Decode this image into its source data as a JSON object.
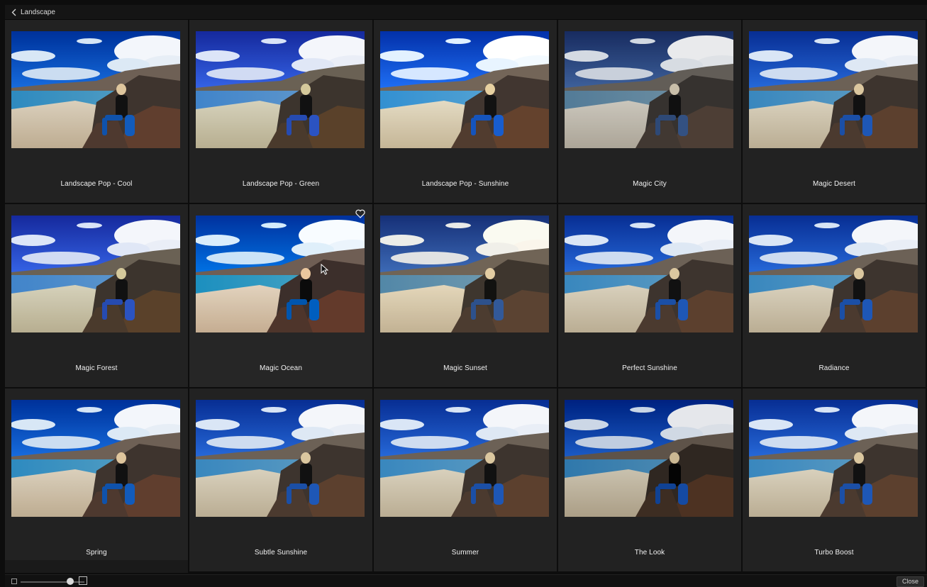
{
  "header": {
    "back_icon": "chevron-left-icon",
    "title": "Landscape"
  },
  "presets": [
    {
      "name": "Landscape Pop - Cool",
      "tint": "cool"
    },
    {
      "name": "Landscape Pop - Green",
      "tint": "green"
    },
    {
      "name": "Landscape Pop - Sunshine",
      "tint": "sunshine"
    },
    {
      "name": "Magic City",
      "tint": "muted"
    },
    {
      "name": "Magic Desert",
      "tint": "normal"
    },
    {
      "name": "Magic Forest",
      "tint": "green"
    },
    {
      "name": "Magic Ocean",
      "tint": "ocean",
      "selected": true,
      "favorite_icon": "heart-outline-icon"
    },
    {
      "name": "Magic Sunset",
      "tint": "sunset"
    },
    {
      "name": "Perfect Sunshine",
      "tint": "normal"
    },
    {
      "name": "Radiance",
      "tint": "normal"
    },
    {
      "name": "Spring",
      "tint": "cool"
    },
    {
      "name": "Subtle Sunshine",
      "tint": "normal"
    },
    {
      "name": "Summer",
      "tint": "normal"
    },
    {
      "name": "The Look",
      "tint": "dark"
    },
    {
      "name": "Turbo Boost",
      "tint": "normal"
    }
  ],
  "footer": {
    "thumb_size_small_icon": "small-square-icon",
    "thumb_size_large_icon": "large-square-icon",
    "thumb_size_level": 0.78,
    "close_label": "Close"
  }
}
